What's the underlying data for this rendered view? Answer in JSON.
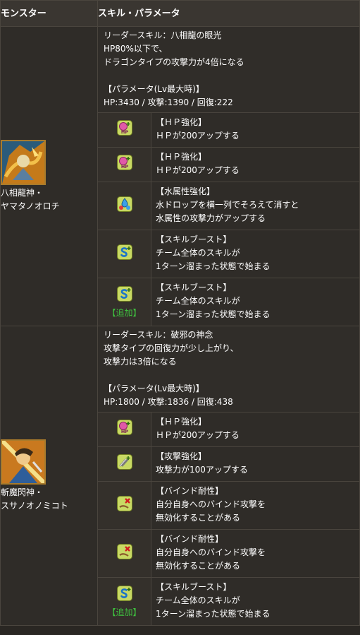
{
  "header": {
    "col_monster": "モンスター",
    "col_skill": "スキル・パラメータ"
  },
  "monsters": [
    {
      "name_line1": "八相龍神・",
      "name_line2": "ヤマタノオロチ",
      "icon": "yamata-no-orochi-portrait",
      "leader_lines": [
        "リーダースキル：八相龍の眼光",
        "HP80%以下で、",
        "ドラゴンタイプの攻撃力が4倍になる"
      ],
      "param_title": "【パラメータ(Lv最大時)】",
      "param_line": "HP:3430 / 攻撃:1390 / 回復:222",
      "awakenings": [
        {
          "icon": "hp-plus-icon",
          "title": "【ＨＰ強化】",
          "lines": [
            "ＨＰが200アップする"
          ],
          "tag": ""
        },
        {
          "icon": "hp-plus-icon",
          "title": "【ＨＰ強化】",
          "lines": [
            "ＨＰが200アップする"
          ],
          "tag": ""
        },
        {
          "icon": "water-attribute-icon",
          "title": "【水属性強化】",
          "lines": [
            "水ドロップを横一列でそろえて消すと",
            "水属性の攻撃力がアップする"
          ],
          "tag": ""
        },
        {
          "icon": "skill-boost-icon",
          "title": "【スキルブースト】",
          "lines": [
            "チーム全体のスキルが",
            "1ターン溜まった状態で始まる"
          ],
          "tag": ""
        },
        {
          "icon": "skill-boost-icon",
          "title": "【スキルブースト】",
          "lines": [
            "チーム全体のスキルが",
            "1ターン溜まった状態で始まる"
          ],
          "tag": "【追加】"
        }
      ]
    },
    {
      "name_line1": "斬魔閃神・",
      "name_line2": "スサノオノミコト",
      "icon": "susanoo-portrait",
      "leader_lines": [
        "リーダースキル：破邪の神念",
        "攻撃タイプの回復力が少し上がり、",
        "攻撃力は3倍になる"
      ],
      "param_title": "【パラメータ(Lv最大時)】",
      "param_line": "HP:1800 / 攻撃:1836 / 回復:438",
      "awakenings": [
        {
          "icon": "hp-plus-icon",
          "title": "【ＨＰ強化】",
          "lines": [
            "ＨＰが200アップする"
          ],
          "tag": ""
        },
        {
          "icon": "attack-plus-icon",
          "title": "【攻撃強化】",
          "lines": [
            "攻撃力が100アップする"
          ],
          "tag": ""
        },
        {
          "icon": "bind-resist-icon",
          "title": "【バインド耐性】",
          "lines": [
            "自分自身へのバインド攻撃を",
            "無効化することがある"
          ],
          "tag": ""
        },
        {
          "icon": "bind-resist-icon",
          "title": "【バインド耐性】",
          "lines": [
            "自分自身へのバインド攻撃を",
            "無効化することがある"
          ],
          "tag": ""
        },
        {
          "icon": "skill-boost-icon",
          "title": "【スキルブースト】",
          "lines": [
            "チーム全体のスキルが",
            "1ターン溜まった状態で始まる"
          ],
          "tag": "【追加】"
        }
      ]
    }
  ]
}
